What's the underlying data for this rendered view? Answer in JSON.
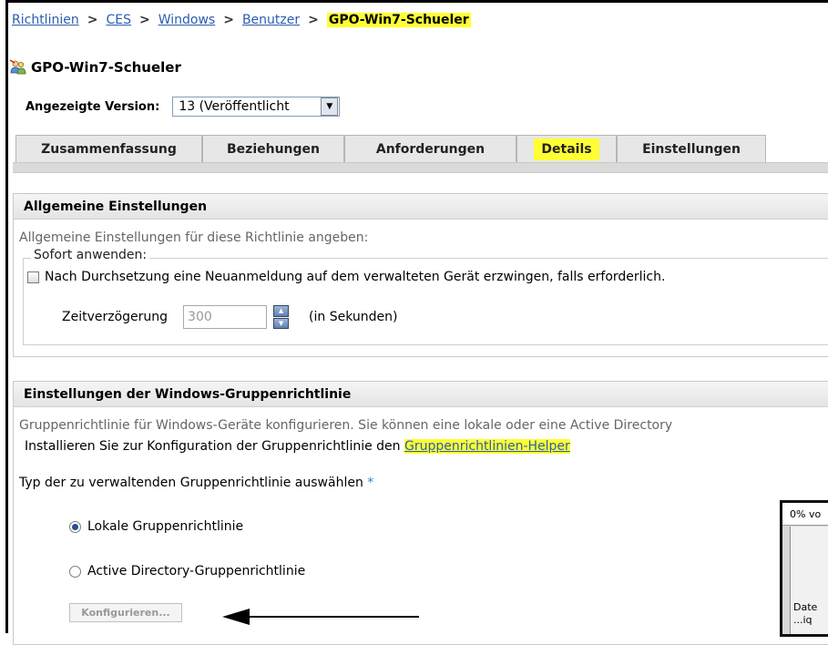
{
  "breadcrumb": {
    "items": [
      "Richtlinien",
      "CES",
      "Windows",
      "Benutzer"
    ],
    "separator": ">",
    "current": "GPO-Win7-Schueler"
  },
  "header": {
    "title": "GPO-Win7-Schueler",
    "icon": "user-group-icon"
  },
  "version": {
    "label": "Angezeigte Version:",
    "value": "13 (Veröffentlicht"
  },
  "tabs": [
    "Zusammenfassung",
    "Beziehungen",
    "Anforderungen",
    "Details",
    "Einstellungen"
  ],
  "active_tab": "Details",
  "general": {
    "title": "Allgemeine Einstellungen",
    "desc": "Allgemeine Einstellungen für diese Richtlinie angeben:",
    "legend": "Sofort anwenden:",
    "checkbox_label": "Nach Durchsetzung eine Neuanmeldung auf dem verwalteten Gerät erzwingen, falls erforderlich.",
    "checkbox_checked": false,
    "delay_label": "Zeitverzögerung",
    "delay_value": "300",
    "delay_unit": "(in Sekunden)"
  },
  "gpo": {
    "title": "Einstellungen der Windows-Gruppenrichtlinie",
    "desc": "Gruppenrichtlinie für Windows-Geräte konfigurieren. Sie können eine lokale oder eine Active Directory",
    "install_text": "Installieren Sie zur Konfiguration der Gruppenrichtlinie den",
    "helper_link": "Gruppenrichtlinien-Helper",
    "type_label": "Typ der zu verwaltenden Gruppenrichtlinie auswählen",
    "required_mark": "*",
    "radio_local": "Lokale Gruppenrichtlinie",
    "radio_ad": "Active Directory-Gruppenrichtlinie",
    "selected": "local",
    "configure_button": "Konfigurieren..."
  },
  "overlay_dialog": {
    "title": "0% vo",
    "line1": "...iq",
    "line2": "Date"
  },
  "colors": {
    "highlight": "#ffff33",
    "link": "#2a5db0",
    "required": "#3a7bd5"
  }
}
